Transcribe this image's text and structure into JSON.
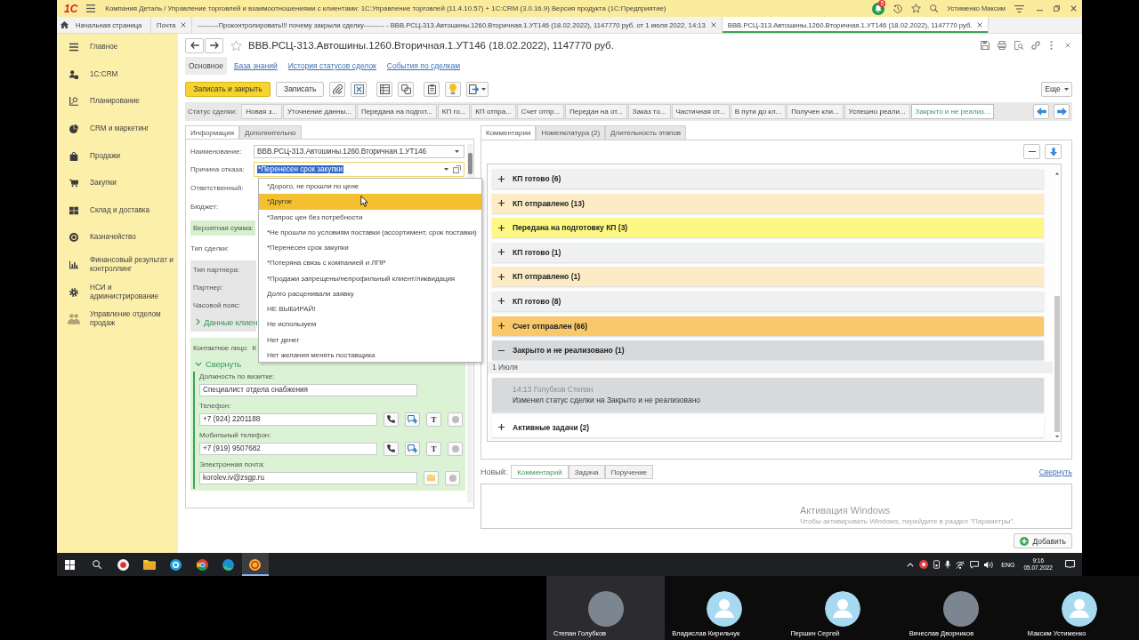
{
  "window": {
    "logo": "1С",
    "title": "Компания Деталь / Управление торговлей и взаимоотношениями с клиентами: 1С:Управление торговлей (11.4.10.57) + 1С:CRM (3.0.16.9) Версия продукта (1С:Предприятие)",
    "notifications": "5",
    "user": "Устименко Максим"
  },
  "open_tabs": [
    {
      "label": "Начальная страница",
      "kind": "home",
      "selected": false
    },
    {
      "label": "Почта",
      "kind": "closable",
      "selected": false
    },
    {
      "label": "---------Проконтролировать!!! почему закрыли сделку--------- - ВВВ.РСЦ-313.Автошины.1260.Вторичная.1.УТ146 (18.02.2022), 1147770 руб. от 1 июля 2022, 14:13",
      "kind": "closable",
      "selected": false
    },
    {
      "label": "ВВВ.РСЦ-313.Автошины.1260.Вторичная.1.УТ146 (18.02.2022), 1147770 руб.",
      "kind": "closable",
      "selected": true
    }
  ],
  "sidebar": {
    "items": [
      {
        "label": "Главное"
      },
      {
        "label": "1С:CRM"
      },
      {
        "label": "Планирование"
      },
      {
        "label": "CRM и маркетинг"
      },
      {
        "label": "Продажи"
      },
      {
        "label": "Закупки"
      },
      {
        "label": "Склад и доставка"
      },
      {
        "label": "Казначейство"
      },
      {
        "label": "Финансовый результат и контроллинг"
      },
      {
        "label": "НСИ и администрирование"
      },
      {
        "label": "Управление отделом продаж"
      }
    ]
  },
  "form": {
    "title": "ВВВ.РСЦ-313.Автошины.1260.Вторичная.1.УТ146 (18.02.2022), 1147770 руб.",
    "nav": [
      {
        "label": "Основное",
        "selected": true
      },
      {
        "label": "База знаний",
        "selected": false
      },
      {
        "label": "История статусов сделок",
        "selected": false
      },
      {
        "label": "События по сделкам",
        "selected": false
      }
    ],
    "toolbar": {
      "save_close": "Записать и закрыть",
      "save": "Записать",
      "more": "Еще"
    },
    "status_bar": {
      "label": "Статус сделки:",
      "stages": [
        {
          "label": "Новая з...",
          "selected": false
        },
        {
          "label": "Уточнение данны...",
          "selected": false
        },
        {
          "label": "Передана на подгот...",
          "selected": false
        },
        {
          "label": "КП го...",
          "selected": false
        },
        {
          "label": "КП отпра...",
          "selected": false
        },
        {
          "label": "Счет отпр...",
          "selected": false
        },
        {
          "label": "Передан на от...",
          "selected": false
        },
        {
          "label": "Заказ то...",
          "selected": false
        },
        {
          "label": "Частичная от...",
          "selected": false
        },
        {
          "label": "В пути до кл...",
          "selected": false
        },
        {
          "label": "Получен кли...",
          "selected": false
        },
        {
          "label": "Успешно реали...",
          "selected": false
        },
        {
          "label": "Закрыто и не реализ...",
          "selected": true
        }
      ]
    }
  },
  "info_panel": {
    "tabs": [
      {
        "label": "Информация",
        "selected": true
      },
      {
        "label": "Дополнительно",
        "selected": false
      }
    ],
    "rows": [
      {
        "kind": "select",
        "label": "Наименование:",
        "value": "ВВВ.РСЦ-313.Автошины.1260.Вторичная.1.УТ146"
      },
      {
        "kind": "choice",
        "label": "Причина отказа:",
        "value": "*Перенесен срок закупки",
        "text_selected": true
      },
      {
        "kind": "label",
        "label": "Ответственный:"
      },
      {
        "kind": "label",
        "label": "Бюджет:"
      },
      {
        "kind": "accent",
        "label": "Вероятная сумма:"
      },
      {
        "kind": "label",
        "label": "Тип сделки:"
      }
    ],
    "partner_group": {
      "rows": [
        {
          "label": "Тип партнера:"
        },
        {
          "label": "Партнер:"
        },
        {
          "label": "Часовой пояс:"
        }
      ],
      "toggle": "Данные клиен",
      "expanded": false
    },
    "contact_group": {
      "label": "Контактное лицо:",
      "value": "К",
      "toggle": "Свернуть",
      "expanded": true,
      "fields": [
        {
          "kind": "text",
          "label": "Должность по визитке:",
          "value": "Специалист отдела снабжения"
        },
        {
          "kind": "phone",
          "label": "Телефон:",
          "value": "+7 (924) 2201188",
          "text_button": "T"
        },
        {
          "kind": "phone",
          "label": "Мобильный телефон:",
          "value": "+7 (919) 9507682",
          "text_button": "T"
        },
        {
          "kind": "email",
          "label": "Электронная почта:",
          "value": "korolev.iv@zsgp.ru"
        }
      ]
    }
  },
  "dropdown": {
    "items": [
      {
        "label": "*Дорого, не прошли по цене",
        "selected": false
      },
      {
        "label": "*Другое",
        "selected": true
      },
      {
        "label": "*Запрос цен без потребности",
        "selected": false
      },
      {
        "label": "*Не прошли по условиям поставки (ассортимент, срок поставки)",
        "selected": false
      },
      {
        "label": "*Перенесен срок закупки",
        "selected": false
      },
      {
        "label": "*Потеряна связь с компанией и ЛПР",
        "selected": false
      },
      {
        "label": "*Продажи запрещены/непрофильный клиент/ликвидация",
        "selected": false
      },
      {
        "label": "Долго расценивали заявку",
        "selected": false
      },
      {
        "label": "НЕ ВЫБИРАЙ!",
        "selected": false
      },
      {
        "label": "Не используем",
        "selected": false
      },
      {
        "label": "Нет денег",
        "selected": false
      },
      {
        "label": "Нет желания менять поставщика",
        "selected": false
      }
    ]
  },
  "comments_panel": {
    "tabs": [
      {
        "label": "Комментарии",
        "selected": true
      },
      {
        "label": "Номенклатура (2)",
        "selected": false
      },
      {
        "label": "Длительность этапов",
        "selected": false
      }
    ],
    "groups": [
      {
        "title": "КП готово (6)",
        "color": "#eff0f2",
        "expanded": false
      },
      {
        "title": "КП отправлено (13)",
        "color": "#fcebc4",
        "expanded": false
      },
      {
        "title": "Передана на подготовку КП (3)",
        "color": "#fdf884",
        "expanded": false
      },
      {
        "title": "КП готово (1)",
        "color": "#eff0f2",
        "expanded": false
      },
      {
        "title": "КП отправлено (1)",
        "color": "#fcebc4",
        "expanded": false
      },
      {
        "title": "КП готово (8)",
        "color": "#eff0f2",
        "expanded": false
      },
      {
        "title": "Счет отправлен (66)",
        "color": "#f8c86a",
        "expanded": false
      },
      {
        "title": "Закрыто и не реализовано (1)",
        "color": "#d7dadd",
        "expanded": true,
        "entries": [
          {
            "date": "1 Июля",
            "comments": [
              {
                "meta": "14:13 Голубков Степан",
                "text": "Изменил статус сделки на Закрыто и не реализовано"
              }
            ]
          }
        ]
      },
      {
        "title": "Активные задачи (2)",
        "color": "#ffffff",
        "expanded": false
      }
    ]
  },
  "new_entry": {
    "label": "Новый:",
    "tabs": [
      {
        "label": "Комментарий",
        "selected": true
      },
      {
        "label": "Задача",
        "selected": false
      },
      {
        "label": "Поручение",
        "selected": false
      }
    ],
    "collapse": "Свернуть",
    "submit": "Добавить"
  },
  "os_notice": {
    "title": "Активация Windows",
    "text": "Чтобы активировать Windows, перейдите в раздел \"Параметры\"."
  },
  "taskbar": {
    "apps": [
      {
        "active": false
      },
      {
        "active": false
      },
      {
        "active": false
      },
      {
        "active": false
      },
      {
        "active": false
      },
      {
        "active": true
      }
    ],
    "tray": {
      "language": "ENG",
      "time": "9:16",
      "date": "05.07.2022"
    }
  },
  "participants": [
    {
      "name": "Степан Голубков",
      "kind": "photo",
      "active": true
    },
    {
      "name": "Владислав Кирильчук",
      "kind": "placeholder",
      "active": false
    },
    {
      "name": "Першин Сергей",
      "kind": "placeholder",
      "active": false
    },
    {
      "name": "Вячеслав Дворников",
      "kind": "photo",
      "active": false
    },
    {
      "name": "Максим Устименко",
      "kind": "placeholder",
      "active": false
    }
  ]
}
